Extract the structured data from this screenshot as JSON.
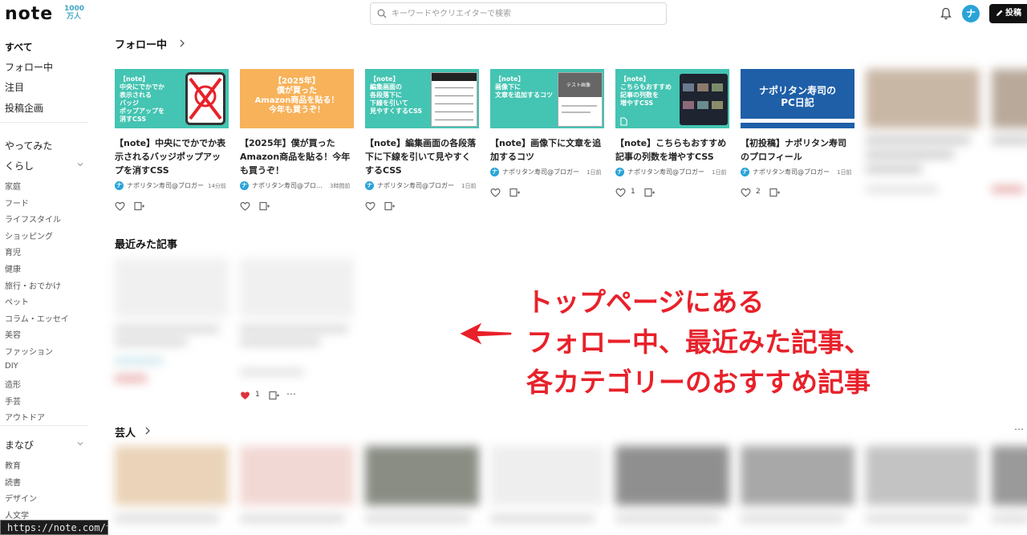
{
  "header": {
    "logo": "note",
    "logo_badge": "1000万人",
    "search_placeholder": "キーワードやクリエイターで検索",
    "avatar_letter": "ナ",
    "post_label": "投稿"
  },
  "sidebar": {
    "top_items": [
      "すべて",
      "フォロー中",
      "注目",
      "投稿企画"
    ],
    "yattemita": "やってみた",
    "kurashi": "くらし",
    "kurashi_items": [
      "家庭",
      "フード",
      "ライフスタイル",
      "ショッピング",
      "育児",
      "健康",
      "旅行・おでかけ",
      "ペット",
      "コラム・エッセイ",
      "美容",
      "ファッション",
      "DIY",
      "造形",
      "手芸",
      "アウトドア"
    ],
    "manabi": "まなび",
    "manabi_items": [
      "教育",
      "読書",
      "デザイン",
      "人文学"
    ]
  },
  "statusbar_url": "https://note.com/t",
  "sections": {
    "following": "フォロー中",
    "recent": "最近みた記事",
    "geinin": "芸人"
  },
  "following_cards": [
    {
      "thumb_lines": [
        "【note】",
        "中央にでかでか",
        "表示される",
        "バッジ",
        "ポップアップを",
        "消すCSS"
      ],
      "title": "【note】中央にでかでか表示されるバッジポップアップを消すCSS",
      "author": "ナポリタン寿司@ブロガー",
      "time": "14分前",
      "likes": ""
    },
    {
      "thumb_lines": [
        "【2025年】",
        "僕が買った",
        "Amazon商品を貼る！",
        "今年も買うぞ！"
      ],
      "title": "【2025年】僕が買ったAmazon商品を貼る！今年も買うぞ！",
      "author": "ナポリタン寿司@ブロガー",
      "time": "3時間前",
      "likes": ""
    },
    {
      "thumb_lines": [
        "【note】",
        "編集画面の",
        "各段落下に",
        "下線を引いて",
        "見やすくするCSS"
      ],
      "title": "【note】編集画面の各段落下に下線を引いて見やすくするCSS",
      "author": "ナポリタン寿司@ブロガー",
      "time": "1日前",
      "likes": ""
    },
    {
      "thumb_lines": [
        "【note】",
        "画像下に",
        "文章を追加するコツ"
      ],
      "thumb_extra": "テスト画像",
      "title": "【note】画像下に文章を追加するコツ",
      "author": "ナポリタン寿司@ブロガー",
      "time": "1日前",
      "likes": ""
    },
    {
      "thumb_lines": [
        "【note】",
        "こちらもおすすめ",
        "記事の列数を",
        "増やすCSS"
      ],
      "title": "【note】こちらもおすすめ記事の列数を増やすCSS",
      "author": "ナポリタン寿司@ブロガー",
      "time": "1日前",
      "likes": "1"
    },
    {
      "thumb_lines": [
        "ナポリタン寿司の",
        "PC日記"
      ],
      "title": "【初投稿】ナポリタン寿司のプロフィール",
      "author": "ナポリタン寿司@ブロガー",
      "time": "1日前",
      "likes": "2"
    }
  ],
  "recent_likes": "1",
  "annotation_lines": [
    "トップページにある",
    "フォロー中、最近みた記事、",
    "各カテゴリーのおすすめ記事"
  ],
  "colors": {
    "teal": "#44c4b2",
    "orange": "#f7b25a",
    "navy": "#1e5fa8",
    "accent_red": "#e8212a",
    "avatar_blue": "#2aa3d6"
  }
}
